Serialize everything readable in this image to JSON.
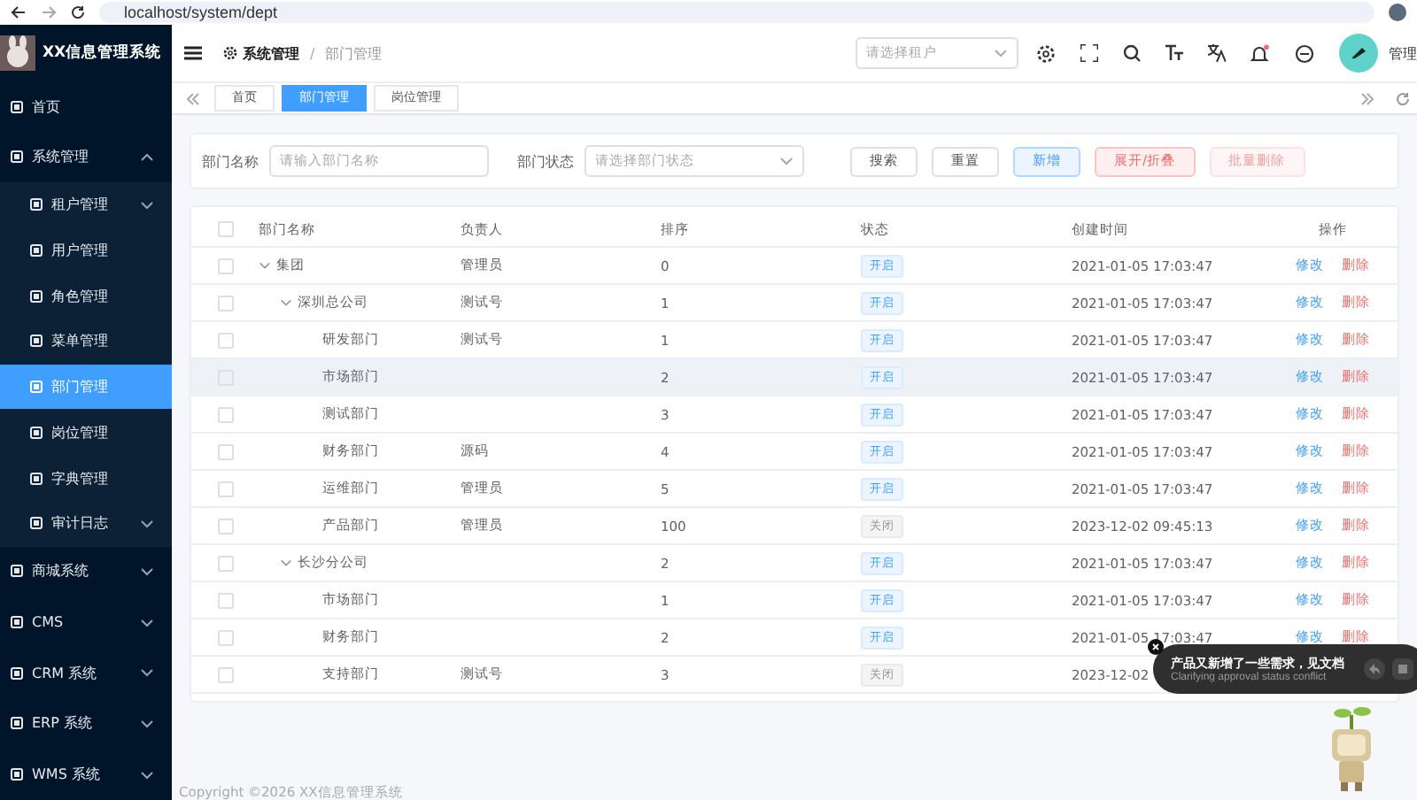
{
  "browser": {
    "url": "localhost/system/dept"
  },
  "sidebar": {
    "title": "XX信息管理系统",
    "items": [
      {
        "label": "首页",
        "selected": false
      },
      {
        "label": "系统管理",
        "selected": false,
        "expanded": true,
        "children": [
          {
            "label": "租户管理",
            "selected": false,
            "expanded": false
          },
          {
            "label": "用户管理",
            "selected": false
          },
          {
            "label": "角色管理",
            "selected": false
          },
          {
            "label": "菜单管理",
            "selected": false
          },
          {
            "label": "部门管理",
            "selected": true
          },
          {
            "label": "岗位管理",
            "selected": false
          },
          {
            "label": "字典管理",
            "selected": false
          },
          {
            "label": "审计日志",
            "selected": false,
            "expanded": false
          }
        ]
      },
      {
        "label": "商城系统",
        "selected": false,
        "expanded": false
      },
      {
        "label": "CMS",
        "selected": false,
        "expanded": false
      },
      {
        "label": "CRM 系统",
        "selected": false,
        "expanded": false
      },
      {
        "label": "ERP 系统",
        "selected": false,
        "expanded": false
      },
      {
        "label": "WMS 系统",
        "selected": false,
        "expanded": false
      }
    ]
  },
  "header": {
    "breadcrumb": [
      "系统管理",
      "/",
      "部门管理"
    ],
    "tenant_select": {
      "placeholder": "请选择租户"
    },
    "user_name": "管理"
  },
  "tabs": [
    {
      "label": "首页",
      "selected": false
    },
    {
      "label": "部门管理",
      "selected": true
    },
    {
      "label": "岗位管理",
      "selected": false
    }
  ],
  "search": {
    "fields": [
      {
        "label": "部门名称",
        "kind": "input",
        "placeholder": "请输入部门名称"
      },
      {
        "label": "部门状态",
        "kind": "select",
        "placeholder": "请选择部门状态"
      }
    ],
    "buttons": [
      {
        "label": "搜索",
        "kind": "search",
        "disabled": false
      },
      {
        "label": "重置",
        "kind": "reset",
        "disabled": false
      },
      {
        "label": "新增",
        "kind": "add",
        "disabled": false
      },
      {
        "label": "展开/折叠",
        "kind": "toggle",
        "disabled": false
      },
      {
        "label": "批量删除",
        "kind": "delete",
        "disabled": true
      }
    ]
  },
  "table": {
    "select_all_checked": false,
    "columns": [
      "部门名称",
      "负责人",
      "排序",
      "状态",
      "创建时间",
      "操作"
    ],
    "rows": [
      {
        "name": "集团",
        "leader": "管理员",
        "sort": "0",
        "status": {
          "label": "开启",
          "on": true
        },
        "created": "2021-01-05 17:03:47",
        "actions": [
          "修改",
          "删除"
        ],
        "checked": false,
        "highlighted": false,
        "expanded": true,
        "children": [
          {
            "name": "深圳总公司",
            "leader": "测试号",
            "sort": "1",
            "status": {
              "label": "开启",
              "on": true
            },
            "created": "2021-01-05 17:03:47",
            "actions": [
              "修改",
              "删除"
            ],
            "checked": false,
            "highlighted": false,
            "expanded": true,
            "children": [
              {
                "name": "研发部门",
                "leader": "测试号",
                "sort": "1",
                "status": {
                  "label": "开启",
                  "on": true
                },
                "created": "2021-01-05 17:03:47",
                "actions": [
                  "修改",
                  "删除"
                ],
                "checked": false,
                "highlighted": false
              },
              {
                "name": "市场部门",
                "sort": "2",
                "status": {
                  "label": "开启",
                  "on": true
                },
                "created": "2021-01-05 17:03:47",
                "actions": [
                  "修改",
                  "删除"
                ],
                "checked": false,
                "highlighted": true
              },
              {
                "name": "测试部门",
                "sort": "3",
                "status": {
                  "label": "开启",
                  "on": true
                },
                "created": "2021-01-05 17:03:47",
                "actions": [
                  "修改",
                  "删除"
                ],
                "checked": false,
                "highlighted": false
              },
              {
                "name": "财务部门",
                "leader": "源码",
                "sort": "4",
                "status": {
                  "label": "开启",
                  "on": true
                },
                "created": "2021-01-05 17:03:47",
                "actions": [
                  "修改",
                  "删除"
                ],
                "checked": false,
                "highlighted": false
              },
              {
                "name": "运维部门",
                "leader": "管理员",
                "sort": "5",
                "status": {
                  "label": "开启",
                  "on": true
                },
                "created": "2021-01-05 17:03:47",
                "actions": [
                  "修改",
                  "删除"
                ],
                "checked": false,
                "highlighted": false
              },
              {
                "name": "产品部门",
                "leader": "管理员",
                "sort": "100",
                "status": {
                  "label": "关闭",
                  "on": false
                },
                "created": "2023-12-02 09:45:13",
                "actions": [
                  "修改",
                  "删除"
                ],
                "checked": false,
                "highlighted": false
              }
            ]
          },
          {
            "name": "长沙分公司",
            "sort": "2",
            "status": {
              "label": "开启",
              "on": true
            },
            "created": "2021-01-05 17:03:47",
            "actions": [
              "修改",
              "删除"
            ],
            "checked": false,
            "highlighted": false,
            "expanded": true,
            "children": [
              {
                "name": "市场部门",
                "sort": "1",
                "status": {
                  "label": "开启",
                  "on": true
                },
                "created": "2021-01-05 17:03:47",
                "actions": [
                  "修改",
                  "删除"
                ],
                "checked": false,
                "highlighted": false
              },
              {
                "name": "财务部门",
                "sort": "2",
                "status": {
                  "label": "开启",
                  "on": true
                },
                "created": "2021-01-05 17:03:47",
                "actions": [
                  "修改",
                  "删除"
                ],
                "checked": false,
                "highlighted": false
              },
              {
                "name": "支持部门",
                "leader": "测试号",
                "sort": "3",
                "status": {
                  "label": "关闭",
                  "on": false
                },
                "created": "2023-12-02",
                "checked": false,
                "highlighted": false
              }
            ]
          }
        ]
      }
    ]
  },
  "footer": "Copyright ©2026 XX信息管理系统",
  "notification": {
    "title": "产品又新增了一些需求，见文档",
    "subtitle": "Clarifying approval status conflict"
  }
}
